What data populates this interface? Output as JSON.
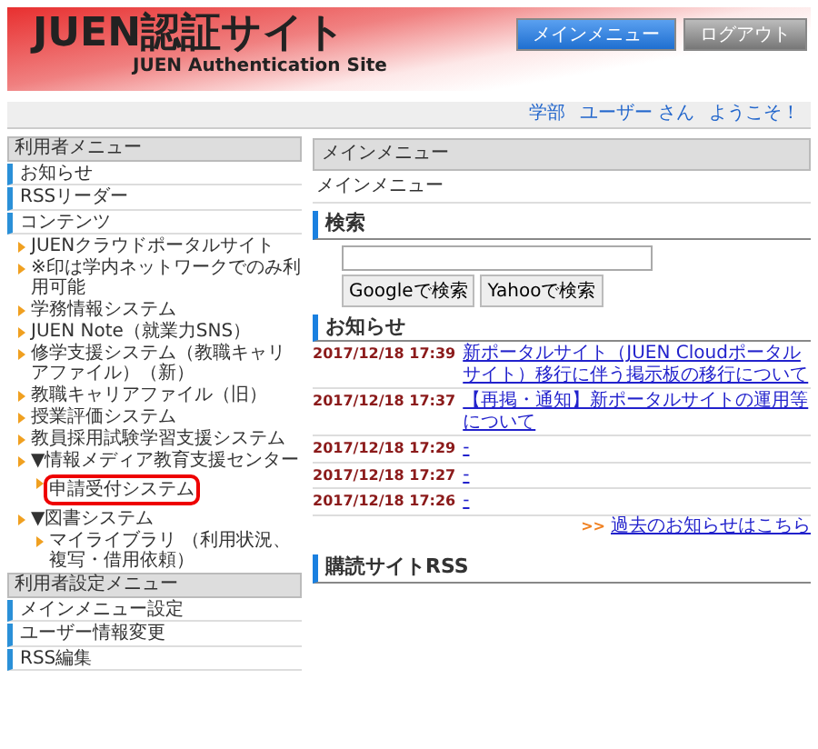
{
  "header": {
    "title": "JUEN認証サイト",
    "subtitle": "JUEN Authentication Site",
    "buttons": [
      {
        "label": "メインメニュー",
        "kind": "primary"
      },
      {
        "label": "ログアウト",
        "kind": "secondary"
      }
    ]
  },
  "user_bar": {
    "department": "学部",
    "user": "ユーザー さん",
    "greeting": "ようこそ！"
  },
  "sidebar": [
    {
      "title": "利用者メニュー",
      "items": [
        {
          "label": "お知らせ"
        },
        {
          "label": "RSSリーダー"
        },
        {
          "label": "コンテンツ",
          "children": [
            {
              "label": "JUENクラウドポータルサイト",
              "highlighted": false
            },
            {
              "label": "※印は学内ネットワークでのみ利用可能",
              "highlighted": false
            },
            {
              "label": "学務情報システム",
              "highlighted": false
            },
            {
              "label": "JUEN Note（就業力SNS）",
              "highlighted": false
            },
            {
              "label": "修学支援システム（教職キャリアファイル）（新）",
              "highlighted": false
            },
            {
              "label": "教職キャリアファイル（旧）",
              "highlighted": false
            },
            {
              "label": "授業評価システム",
              "highlighted": false
            },
            {
              "label": "教員採用試験学習支援システム",
              "highlighted": false
            },
            {
              "label": "▼情報メディア教育支援センター",
              "highlighted": false,
              "children": [
                {
                  "label": "申請受付システム",
                  "highlighted": true
                }
              ]
            },
            {
              "label": "▼図書システム",
              "highlighted": false,
              "children": [
                {
                  "label": "マイライブラリ （利用状況、複写・借用依頼）",
                  "highlighted": false
                }
              ]
            }
          ]
        }
      ]
    },
    {
      "title": "利用者設定メニュー",
      "items": [
        {
          "label": "メインメニュー設定"
        },
        {
          "label": "ユーザー情報変更"
        },
        {
          "label": "RSS編集"
        }
      ]
    }
  ],
  "main": {
    "panel_title": "メインメニュー",
    "breadcrumb": "メインメニュー",
    "search": {
      "heading": "検索",
      "buttons": [
        "Googleで検索",
        "Yahooで検索"
      ]
    },
    "news": {
      "heading": "お知らせ",
      "items": [
        {
          "date": "2017/12/18 17:39",
          "title": "新ポータルサイト（JUEN Cloudポータルサイト）移行に伴う掲示板の移行について"
        },
        {
          "date": "2017/12/18 17:37",
          "title": "【再掲・通知】新ポータルサイトの運用等について"
        },
        {
          "date": "2017/12/18 17:29",
          "title": "-"
        },
        {
          "date": "2017/12/18 17:27",
          "title": "-"
        },
        {
          "date": "2017/12/18 17:26",
          "title": "-"
        }
      ],
      "more_marker": ">>",
      "more_link": "過去のお知らせはこちら"
    },
    "rss": {
      "heading": "購読サイトRSS"
    }
  }
}
